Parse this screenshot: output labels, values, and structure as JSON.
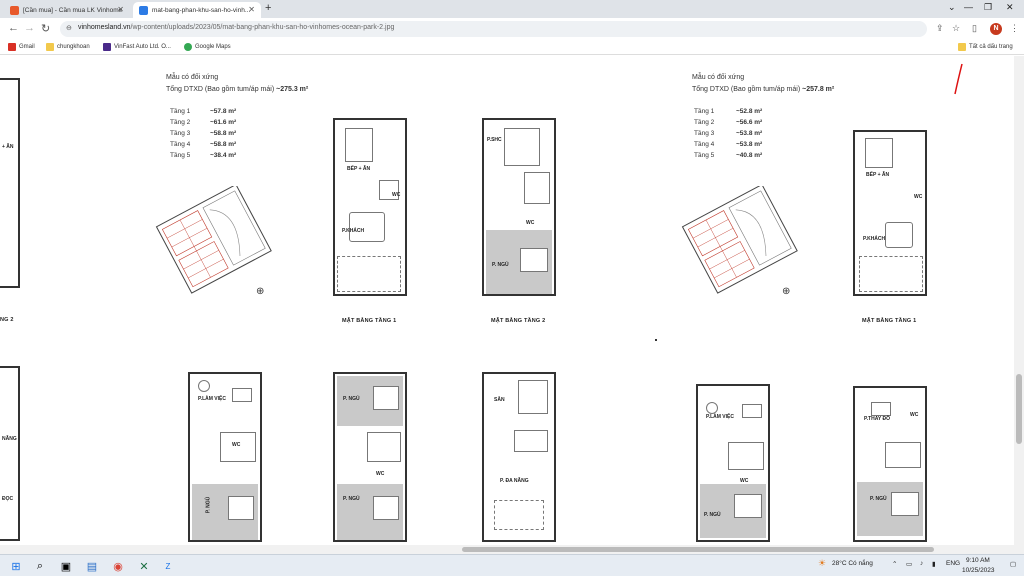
{
  "tabs": [
    {
      "title": "[Cần mua] - Cần mua LK Vinhome",
      "active": false
    },
    {
      "title": "mat-bang-phan-khu-san-ho-vinh...",
      "active": true
    }
  ],
  "address_bar": {
    "domain": "vinhomesland.vn",
    "path": "/wp-content/uploads/2023/05/mat-bang-phan-khu-san-ho-vinhomes-ocean-park-2.jpg"
  },
  "profile_initial": "N",
  "bookmarks": [
    {
      "label": "Gmail"
    },
    {
      "label": "chungkhoan"
    },
    {
      "label": "VinFast Auto Ltd. O..."
    },
    {
      "label": "Google Maps"
    }
  ],
  "all_bookmarks_label": "Tất cả dấu trang",
  "left_card": {
    "title": "Mẫu có đối xứng",
    "total_label": "Tổng DTXD (Bao gồm tum/áp mái)",
    "total_value": "~275.3 m²",
    "floors": [
      {
        "name": "Tầng 1",
        "area": "~57.8 m²"
      },
      {
        "name": "Tầng 2",
        "area": "~61.6 m²"
      },
      {
        "name": "Tầng 3",
        "area": "~58.8 m²"
      },
      {
        "name": "Tầng 4",
        "area": "~58.8 m²"
      },
      {
        "name": "Tầng 5",
        "area": "~38.4 m²"
      }
    ]
  },
  "right_card": {
    "title": "Mẫu có đối xứng",
    "total_label": "Tổng DTXD (Bao gồm tum/áp mái)",
    "total_value": "~257.8 m²",
    "floors": [
      {
        "name": "Tầng 1",
        "area": "~52.8 m²"
      },
      {
        "name": "Tầng 2",
        "area": "~56.6 m²"
      },
      {
        "name": "Tầng 3",
        "area": "~53.8 m²"
      },
      {
        "name": "Tầng 4",
        "area": "~53.8 m²"
      },
      {
        "name": "Tầng 5",
        "area": "~40.8 m²"
      }
    ]
  },
  "captions": {
    "left_partial": "NG 2",
    "f1": "MẶT BẰNG TẦNG 1",
    "f2": "MẶT BẰNG TẦNG 2",
    "f1_right": "MẶT BẰNG TẦNG 1"
  },
  "rooms": {
    "bep_an": "BẾP + ĂN",
    "wc": "WC",
    "p_khach": "P.KHÁCH",
    "p_shc": "P.SHC",
    "p_ngu": "P. NGỦ",
    "p_lam_viec": "P.LÀM VIỆC",
    "san": "SÂN",
    "p_da_nang": "P. ĐA NĂNG",
    "p_thay_do": "P.THAY ĐỒ",
    "left_an": "+ ĂN",
    "left_nang": "NĂNG",
    "left_doc": "ĐỌC"
  },
  "taskbar": {
    "weather": "28°C Có nắng",
    "lang": "ENG",
    "time": "9:10 AM",
    "date": "10/25/2023"
  }
}
